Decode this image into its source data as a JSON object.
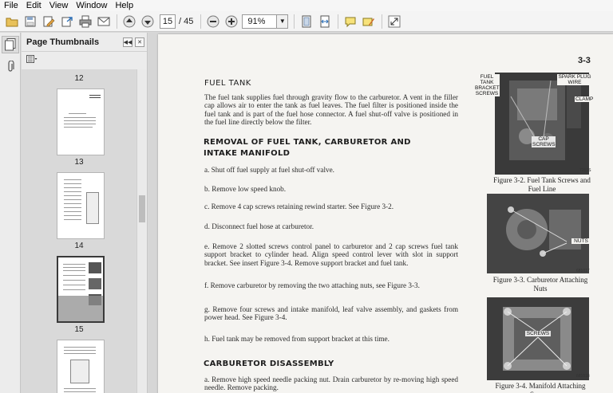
{
  "menu": [
    "File",
    "Edit",
    "View",
    "Window",
    "Help"
  ],
  "toolbar": {
    "current_page": "15",
    "total_pages": "/ 45",
    "zoom": "91%",
    "icons": [
      "open-icon",
      "save-icon",
      "edit-icon",
      "export-icon",
      "print-icon",
      "email-icon",
      "prev-page-icon",
      "next-page-icon",
      "zoom-out-icon",
      "zoom-in-icon",
      "fit-page-icon",
      "fit-width-icon",
      "comment-icon",
      "highlight-icon",
      "expand-icon"
    ]
  },
  "sidebar": {
    "title": "Page Thumbnails",
    "thumbnails": [
      {
        "label": "12"
      },
      {
        "label": "13"
      },
      {
        "label": "14"
      },
      {
        "label": "15"
      }
    ],
    "selected_thumbnail": "15"
  },
  "document": {
    "page_number": "3-3",
    "fuel_tank_heading": "FUEL TANK",
    "fuel_tank_text": "The fuel tank supplies fuel through gravity flow to the carburetor. A vent in the filler cap allows air to enter the tank as fuel leaves. The fuel filter is positioned inside the fuel tank and is part of the fuel hose connector. A fuel shut-off valve is positioned in the fuel line directly below the filter.",
    "removal_heading": "REMOVAL OF FUEL TANK, CARBURETOR AND INTAKE MANIFOLD",
    "steps": [
      "a. Shut off fuel supply at fuel shut-off valve.",
      "b. Remove low speed knob.",
      "c. Remove 4 cap screws retaining rewind starter. See Figure 3-2.",
      "d. Disconnect fuel hose at carburetor.",
      "e. Remove 2 slotted screws control panel to carburetor and 2 cap screws fuel tank support bracket to cylinder head. Align speed control lever with slot in support bracket. See insert Figure 3-4. Remove support bracket and fuel tank.",
      "f. Remove carburetor by removing the two attaching nuts, see Figure 3-3.",
      "g. Remove four screws and intake manifold, leaf valve assembly, and gaskets from power head. See Figure 3-4.",
      "h. Fuel tank may be removed from support bracket at this time."
    ],
    "carb_heading": "CARBURETOR DISASSEMBLY",
    "carb_text": "a. Remove high speed needle packing nut. Drain carburetor by re-moving high speed needle. Remove packing."
  },
  "figures": [
    {
      "caption": "Figure 3-2. Fuel Tank Screws and Fuel Line",
      "callouts": [
        "FUEL TANK BRACKET SCREWS",
        "SPARK PLUG WIRE",
        "CLAMP",
        "CAP SCREWS"
      ],
      "code": "7251S"
    },
    {
      "caption": "Figure 3-3. Carburetor Attaching Nuts",
      "callouts": [
        "NUTS"
      ],
      "code": "681017"
    },
    {
      "caption": "Figure 3-4. Manifold Attaching Screws",
      "callouts": [
        "SCREWS"
      ],
      "code": "681018"
    }
  ],
  "colors": {
    "page_background": "#f5f4f1",
    "chrome": "#f4f4f4",
    "panel": "#ececec",
    "doc_background": "#d6d6d6"
  }
}
